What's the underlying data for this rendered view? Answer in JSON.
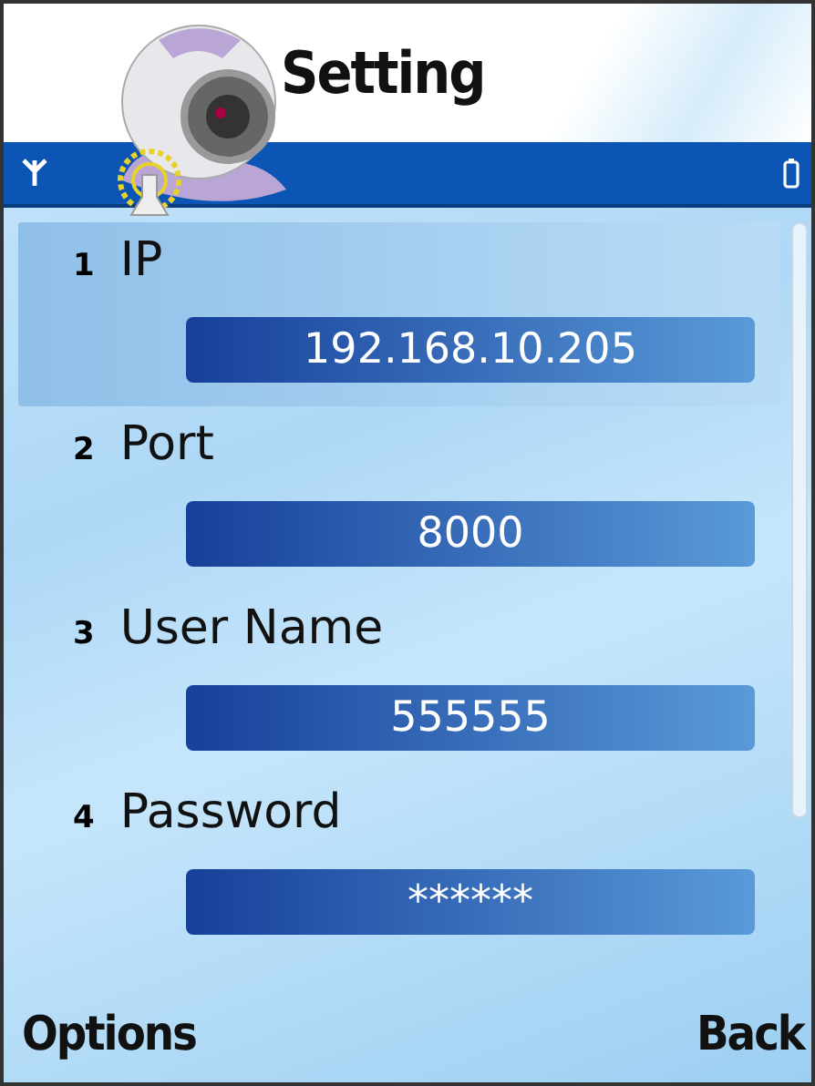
{
  "title": "Setting",
  "fields": [
    {
      "number": "1",
      "label": "IP",
      "value": "192.168.10.205",
      "selected": true
    },
    {
      "number": "2",
      "label": "Port",
      "value": "8000",
      "selected": false
    },
    {
      "number": "3",
      "label": "User Name",
      "value": "555555",
      "selected": false
    },
    {
      "number": "4",
      "label": "Password",
      "value": "******",
      "selected": false
    }
  ],
  "softkeys": {
    "left": "Options",
    "right": "Back"
  }
}
